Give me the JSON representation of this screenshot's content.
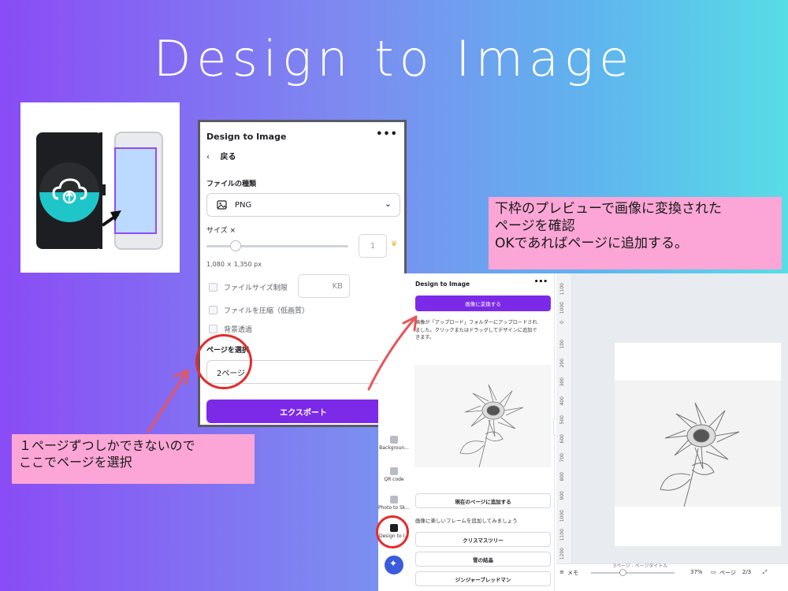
{
  "title": "Design to Image",
  "left_panel": {
    "title": "Design to Image",
    "more": "•••",
    "back": "戻る",
    "file_type_label": "ファイルの種類",
    "file_type_value": "PNG",
    "size_label": "サイズ ×",
    "size_value": "1",
    "dimensions": "1,080 × 1,350 px",
    "limit_size_label": "ファイルサイズ制限",
    "kb_unit": "KB",
    "compress_label": "ファイルを圧縮（低画質）",
    "transparent_label": "背景透過",
    "page_select_label": "ページを選択",
    "page_select_value": "2ページ",
    "export_button": "エクスポート"
  },
  "note_top": {
    "line1": "下枠のプレビューで画像に変換された",
    "line2": "ページを確認",
    "line3": "OKであればページに追加する。"
  },
  "note_bottom": {
    "line1": "１ページずつしかできないので",
    "line2": "ここでページを選択"
  },
  "right_panel": {
    "title": "Design to Image",
    "more": "•••",
    "convert_button": "画像に変換する",
    "desc_line1": "画像が「アップロード」フォルダーにアップロードされ",
    "desc_line2": "ました。クリックまたはドラッグしてデザインに追加で",
    "desc_line3": "きます。",
    "add_to_page_button": "現在のページに追加する",
    "frame_prompt": "画像に楽しいフレームを追加してみましょう",
    "frame_option_1": "クリスマスツリー",
    "frame_option_2": "雪の結晶",
    "frame_option_3": "ジンジャーブレッドマン"
  },
  "sidebar_tools": {
    "background": "Backgroun...",
    "qr": "QR code",
    "photo": "Photo to Sk...",
    "design": "Design to I..."
  },
  "ruler_ticks": [
    "1100",
    "1000",
    "0",
    "100",
    "200",
    "300",
    "400",
    "500",
    "600",
    "700",
    "800",
    "900",
    "1000",
    "1100",
    "1200"
  ],
  "bottom_bar": {
    "memo": "メモ",
    "zoom": "37%",
    "pages_label": "ページ",
    "page_count": "2/3",
    "page_caption": "3ページ - ページタイトル"
  },
  "colors": {
    "accent_purple": "#7d2ae8",
    "note_pink": "#fba6d6",
    "annotation_red": "#e52b2b",
    "app_icon_teal": "#1fc6c9"
  }
}
